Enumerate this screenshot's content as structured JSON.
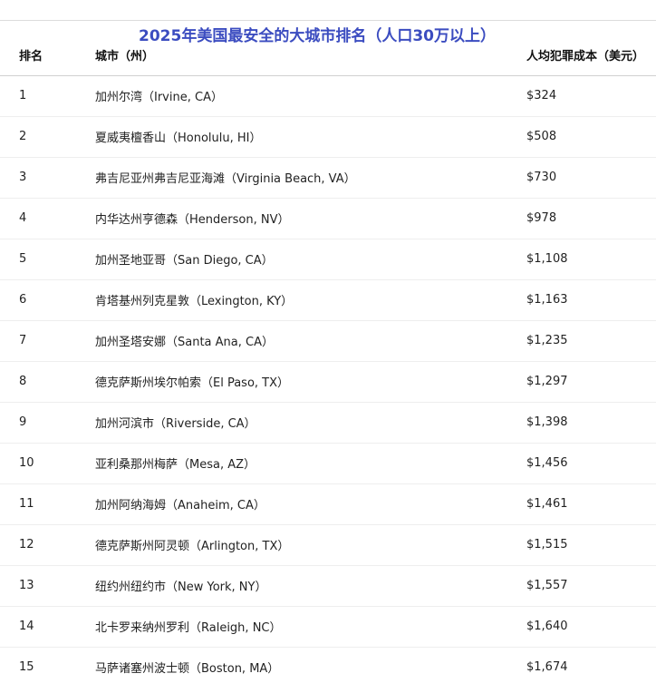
{
  "title": "2025年美国最安全的大城市排名（人口30万以上）",
  "table": {
    "headers": {
      "rank": "排名",
      "city": "城市（州）",
      "cost": "人均犯罪成本（美元）"
    },
    "rows": [
      {
        "rank": "1",
        "city": "加州尔湾（Irvine, CA）",
        "cost": "$324"
      },
      {
        "rank": "2",
        "city": "夏威夷檀香山（Honolulu, HI）",
        "cost": "$508"
      },
      {
        "rank": "3",
        "city": "弗吉尼亚州弗吉尼亚海滩（Virginia Beach, VA）",
        "cost": "$730"
      },
      {
        "rank": "4",
        "city": "内华达州亨德森（Henderson, NV）",
        "cost": "$978"
      },
      {
        "rank": "5",
        "city": "加州圣地亚哥（San Diego, CA）",
        "cost": "$1,108"
      },
      {
        "rank": "6",
        "city": "肯塔基州列克星敦（Lexington, KY）",
        "cost": "$1,163"
      },
      {
        "rank": "7",
        "city": "加州圣塔安娜（Santa Ana, CA）",
        "cost": "$1,235"
      },
      {
        "rank": "8",
        "city": "德克萨斯州埃尔帕索（El Paso, TX）",
        "cost": "$1,297"
      },
      {
        "rank": "9",
        "city": "加州河滨市（Riverside, CA）",
        "cost": "$1,398"
      },
      {
        "rank": "10",
        "city": "亚利桑那州梅萨（Mesa, AZ）",
        "cost": "$1,456"
      },
      {
        "rank": "11",
        "city": "加州阿纳海姆（Anaheim, CA）",
        "cost": "$1,461"
      },
      {
        "rank": "12",
        "city": "德克萨斯州阿灵顿（Arlington, TX）",
        "cost": "$1,515"
      },
      {
        "rank": "13",
        "city": "纽约州纽约市（New York, NY）",
        "cost": "$1,557"
      },
      {
        "rank": "14",
        "city": "北卡罗来纳州罗利（Raleigh, NC）",
        "cost": "$1,640"
      },
      {
        "rank": "15",
        "city": "马萨诸塞州波士顿（Boston, MA）",
        "cost": "$1,674"
      }
    ]
  },
  "colors": {
    "title": "#3b4cc0",
    "text": "#222222",
    "header_rule": "#d0d0d0",
    "row_rule": "#eeeeee"
  }
}
